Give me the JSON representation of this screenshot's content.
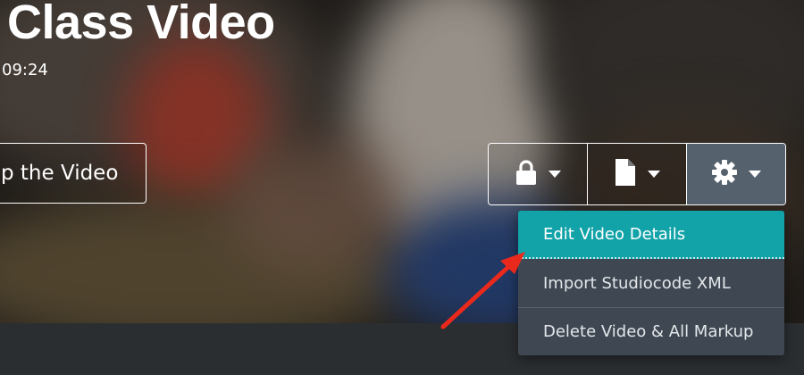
{
  "video": {
    "title": "Class Video",
    "duration": "09:24"
  },
  "actions": {
    "primary_label": "p the Video"
  },
  "toolbar": {
    "buttons": [
      {
        "icon": "lock-icon"
      },
      {
        "icon": "document-icon"
      },
      {
        "icon": "gear-icon",
        "active": true
      }
    ]
  },
  "settings_menu": {
    "items": [
      {
        "label": "Edit Video Details",
        "highlighted": true
      },
      {
        "label": "Import Studiocode XML"
      },
      {
        "label": "Delete Video & All Markup"
      }
    ]
  },
  "colors": {
    "menu_bg": "#3f4852",
    "menu_highlight": "#12a3a8",
    "toolbar_active": "#56616e",
    "annotation_arrow": "#e8291c"
  }
}
